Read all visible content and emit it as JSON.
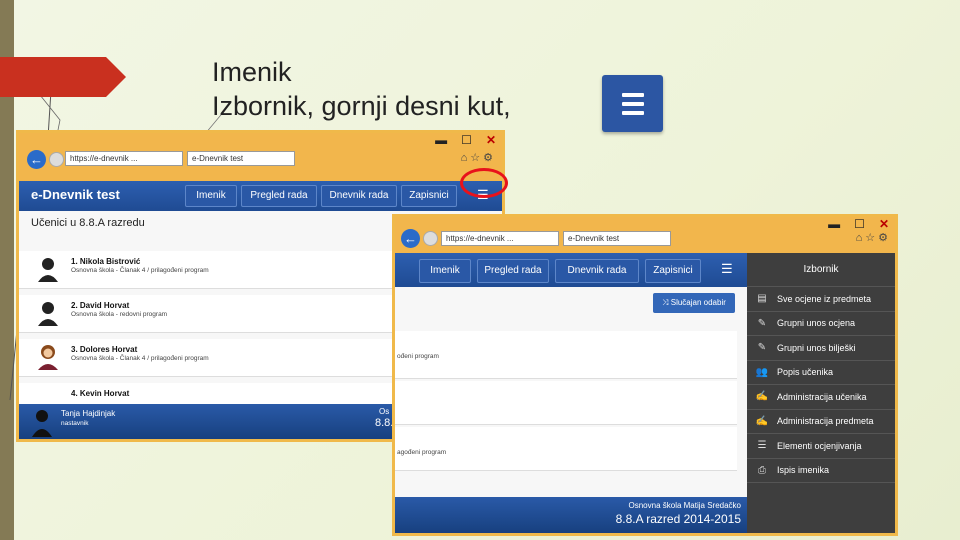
{
  "slide": {
    "title_line1": "Imenik",
    "title_line2": "Izbornik, gornji desni kut,"
  },
  "window1": {
    "address": "https://e-dnevnik ...",
    "tab_title": "e-Dnevnik test",
    "brand": "e-Dnevnik test",
    "nav": [
      "Imenik",
      "Pregled rada",
      "Dnevnik rada",
      "Zapisnici"
    ],
    "section_title": "Učenici u 8.8.A razredu",
    "students": [
      {
        "name": "1. Nikola Bistrović",
        "desc": "Osnovna škola - Članak 4 / prilagođeni program"
      },
      {
        "name": "2. David Horvat",
        "desc": "Osnovna škola - redovni program"
      },
      {
        "name": "3. Dolores Horvat",
        "desc": "Osnovna škola - Članak 4 / prilagođeni program"
      },
      {
        "name": "4. Kevin Horvat",
        "desc": ""
      }
    ],
    "footer": {
      "user_name": "Tanja Hajdinjak",
      "user_role": "nastavnik",
      "school_short": "Os",
      "class_short": "8.8."
    }
  },
  "window2": {
    "address": "https://e-dnevnik ...",
    "tab_title": "e-Dnevnik test",
    "nav": [
      "Imenik",
      "Pregled rada",
      "Dnevnik rada",
      "Zapisnici"
    ],
    "random_button": "Slučajan odabir",
    "rows": [
      "ođeni program",
      "",
      "agođeni program"
    ],
    "footer": {
      "school": "Osnovna škola Matija Sredačko",
      "class": "8.8.A razred 2014-2015"
    },
    "sidebar": {
      "title": "Izbornik",
      "items": [
        {
          "label": "Sve ocjene iz predmeta",
          "icon": "table-icon"
        },
        {
          "label": "Grupni unos ocjena",
          "icon": "pencil-icon"
        },
        {
          "label": "Grupni unos bilješki",
          "icon": "pencil-icon"
        },
        {
          "label": "Popis učenika",
          "icon": "users-icon"
        },
        {
          "label": "Administracija učenika",
          "icon": "edit-icon"
        },
        {
          "label": "Administracija predmeta",
          "icon": "edit-icon"
        },
        {
          "label": "Elementi ocjenjivanja",
          "icon": "list-icon"
        },
        {
          "label": "Ispis imenika",
          "icon": "print-icon"
        }
      ]
    }
  },
  "colors": {
    "accent": "#2c56a3",
    "chrome": "#f2b64c",
    "sidebar": "#3e3e3e",
    "highlight": "#e8121b"
  }
}
